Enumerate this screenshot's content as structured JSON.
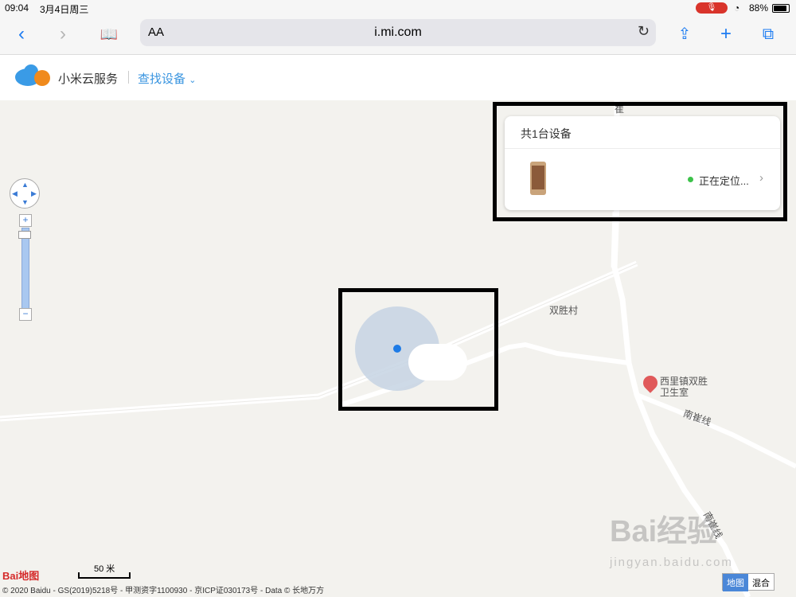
{
  "status_bar": {
    "time": "09:04",
    "date": "3月4日周三",
    "battery": "88%"
  },
  "browser": {
    "font_toggle": "AA",
    "url": "i.mi.com",
    "back_icon": "‹",
    "forward_icon": "›",
    "bookmarks_icon": "📖",
    "share_icon": "⇪",
    "new_tab_icon": "+",
    "tabs_icon": "⧉",
    "reload_icon": "↻"
  },
  "header": {
    "brand": "小米云服务",
    "nav_label": "查找设备"
  },
  "device_panel": {
    "title": "共1台设备",
    "status": "正在定位...",
    "status_color": "#3cc24a"
  },
  "map": {
    "labels": {
      "village": "双胜村",
      "poi_line1": "西里镇双胜",
      "poi_line2": "卫生室",
      "road_nancui": "南崔线",
      "road_top": "崔",
      "road_bottom": "南崔线"
    },
    "scale": "50 米",
    "map_type": [
      "地图",
      "混合"
    ],
    "copyright": "© 2020 Baidu - GS(2019)5218号 - 甲测资字1100930 - 京ICP证030173号 - Data © 长地万方",
    "baidu_logo": "Bai地图"
  },
  "watermark": {
    "main": "Bai经验",
    "sub": "jingyan.baidu.com"
  },
  "colors": {
    "accent": "#1d7cf2",
    "link": "#3a95e0",
    "location_dot": "#1e7be6",
    "accuracy_circle": "#c5d3e3"
  }
}
